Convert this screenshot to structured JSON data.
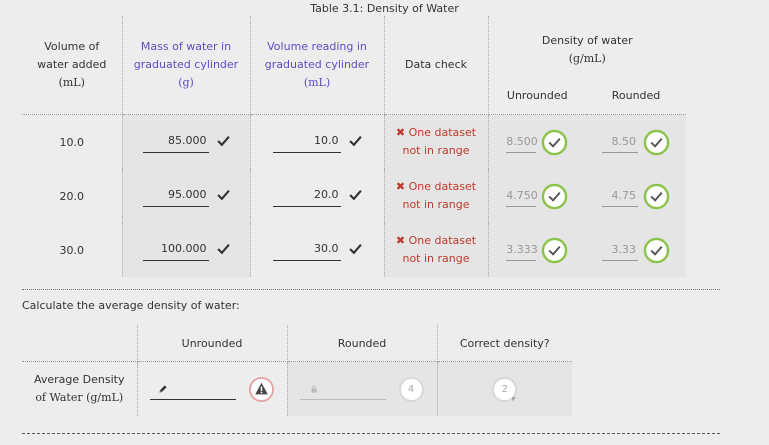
{
  "caption": "Table 3.1: Density of Water",
  "headers": {
    "volume_added": [
      "Volume of",
      "water added"
    ],
    "volume_added_unit": "(mL)",
    "mass": [
      "Mass of water in",
      "graduated cylinder"
    ],
    "mass_unit": "(g)",
    "volume_reading": [
      "Volume reading in",
      "graduated cylinder"
    ],
    "volume_reading_unit": "(mL)",
    "data_check": "Data check",
    "density": "Density of water",
    "density_unit": "(g/mL)",
    "unrounded": "Unrounded",
    "rounded": "Rounded"
  },
  "rows": [
    {
      "volume": "10.0",
      "mass": "85.000",
      "reading": "10.0",
      "error": [
        "One dataset",
        "not in range"
      ],
      "unrounded": "8.500",
      "rounded": "8.50"
    },
    {
      "volume": "20.0",
      "mass": "95.000",
      "reading": "20.0",
      "error": [
        "One dataset",
        "not in range"
      ],
      "unrounded": "4.750",
      "rounded": "4.75"
    },
    {
      "volume": "30.0",
      "mass": "100.000",
      "reading": "30.0",
      "error": [
        "One dataset",
        "not in range"
      ],
      "unrounded": "3.333",
      "rounded": "3.33"
    }
  ],
  "prompt": "Calculate the average density of water:",
  "avg_table": {
    "col_unrounded": "Unrounded",
    "col_rounded": "Rounded",
    "col_correct": "Correct density?",
    "row_label": [
      "Average Density",
      "of Water (g/mL)"
    ],
    "unrounded_value": "",
    "rounded_value": "",
    "rounded_badge": "4",
    "correct_badge": "2"
  },
  "icons": {
    "check": "check-icon",
    "error": "x-icon",
    "pencil": "pencil-icon",
    "lock": "lock-icon",
    "warning": "warning-icon"
  },
  "colors": {
    "header_purple": "#5b4ec4",
    "error_red": "#c0392b",
    "check_green": "#8bc34a",
    "warning_ring": "#e8a5a5"
  }
}
